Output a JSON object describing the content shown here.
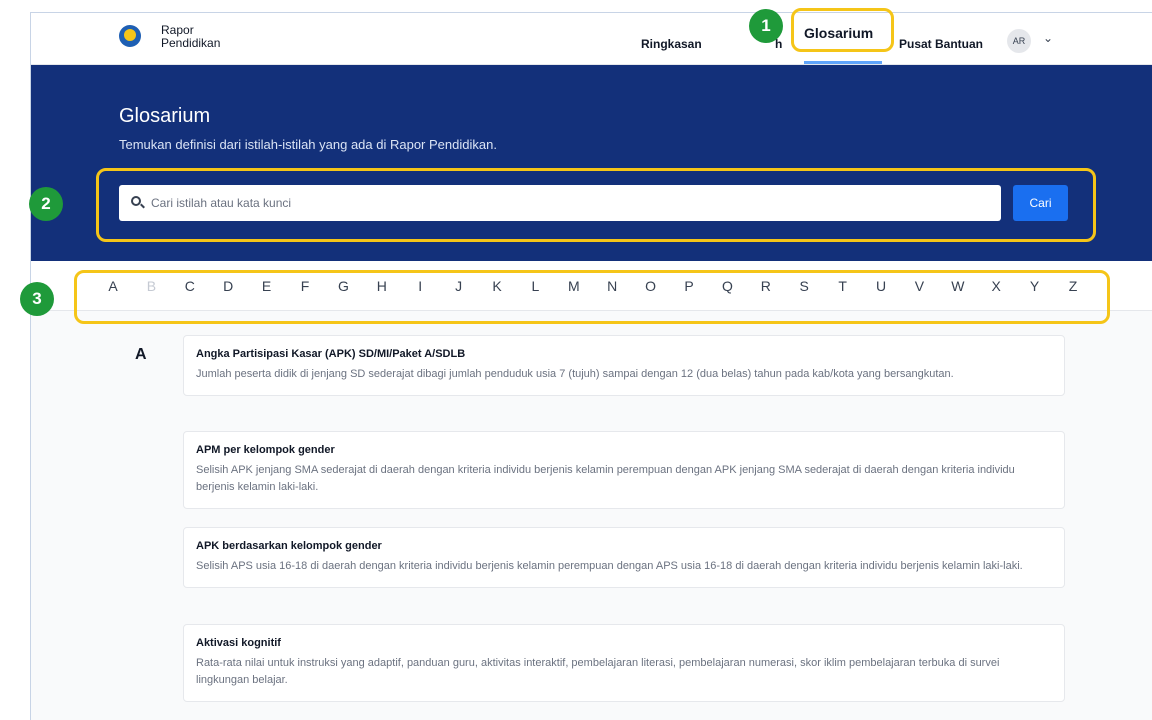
{
  "brand": {
    "line1": "Rapor",
    "line2": "Pendidikan"
  },
  "nav": {
    "items": [
      {
        "label": "Ringkasan"
      },
      {
        "label": "h"
      },
      {
        "label": "Glosarium"
      },
      {
        "label": "Pusat Bantuan"
      }
    ],
    "avatar": "AR"
  },
  "hero": {
    "title": "Glosarium",
    "subtitle": "Temukan definisi dari istilah-istilah yang ada di Rapor Pendidikan."
  },
  "search": {
    "placeholder": "Cari istilah atau kata kunci",
    "value": "",
    "button": "Cari"
  },
  "alphabet": {
    "letters": [
      "A",
      "B",
      "C",
      "D",
      "E",
      "F",
      "G",
      "H",
      "I",
      "J",
      "K",
      "L",
      "M",
      "N",
      "O",
      "P",
      "Q",
      "R",
      "S",
      "T",
      "U",
      "V",
      "W",
      "X",
      "Y",
      "Z"
    ],
    "disabled": [
      "B"
    ]
  },
  "section": {
    "letter": "A"
  },
  "entries": [
    {
      "title": "Angka Partisipasi Kasar (APK) SD/MI/Paket A/SDLB",
      "desc": "Jumlah peserta didik di jenjang SD sederajat dibagi jumlah penduduk usia 7 (tujuh) sampai dengan 12 (dua belas) tahun pada kab/kota yang bersangkutan."
    },
    {
      "title": "APM per kelompok gender",
      "desc": "Selisih APK jenjang SMA sederajat di daerah dengan kriteria individu berjenis kelamin perempuan dengan APK jenjang SMA sederajat di daerah dengan kriteria individu berjenis kelamin laki-laki."
    },
    {
      "title": "APK berdasarkan kelompok gender",
      "desc": "Selisih APS usia 16-18 di daerah dengan kriteria individu berjenis kelamin perempuan dengan APS usia 16-18 di daerah dengan kriteria individu berjenis kelamin laki-laki."
    },
    {
      "title": "Aktivasi kognitif",
      "desc": "Rata-rata nilai untuk instruksi yang adaptif, panduan guru, aktivitas interaktif, pembelajaran literasi, pembelajaran numerasi, skor iklim pembelajaran terbuka di survei lingkungan belajar."
    }
  ],
  "annotations": [
    "1",
    "2",
    "3"
  ],
  "colors": {
    "hero_bg": "#13307a",
    "primary_button": "#1a6ff0",
    "annotation_box": "#f5c518",
    "annotation_badge": "#1f9a3a"
  }
}
